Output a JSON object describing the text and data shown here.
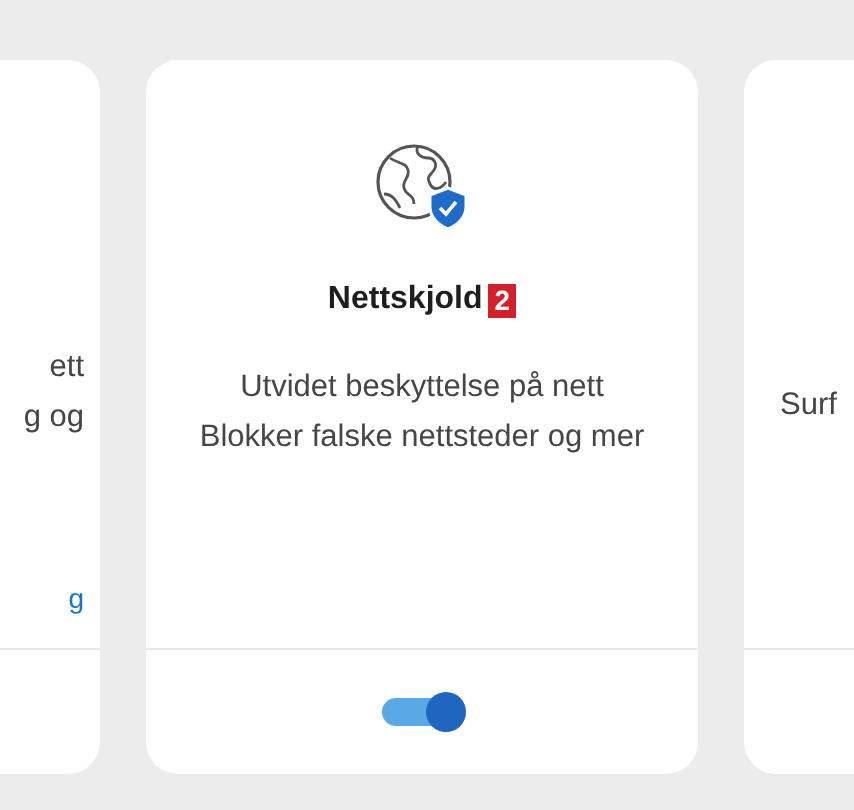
{
  "cards": [
    {
      "kind": "partial_left",
      "lines": [
        "ett",
        "g og"
      ],
      "link": "g"
    },
    {
      "kind": "feature",
      "title": "Nettskjold",
      "badge": "2",
      "description": "Utvidet beskyttelse på nett Blokker falske nettsteder og mer",
      "toggle": {
        "on": true
      }
    },
    {
      "kind": "partial_right",
      "lines": [
        "Surf"
      ]
    }
  ]
}
